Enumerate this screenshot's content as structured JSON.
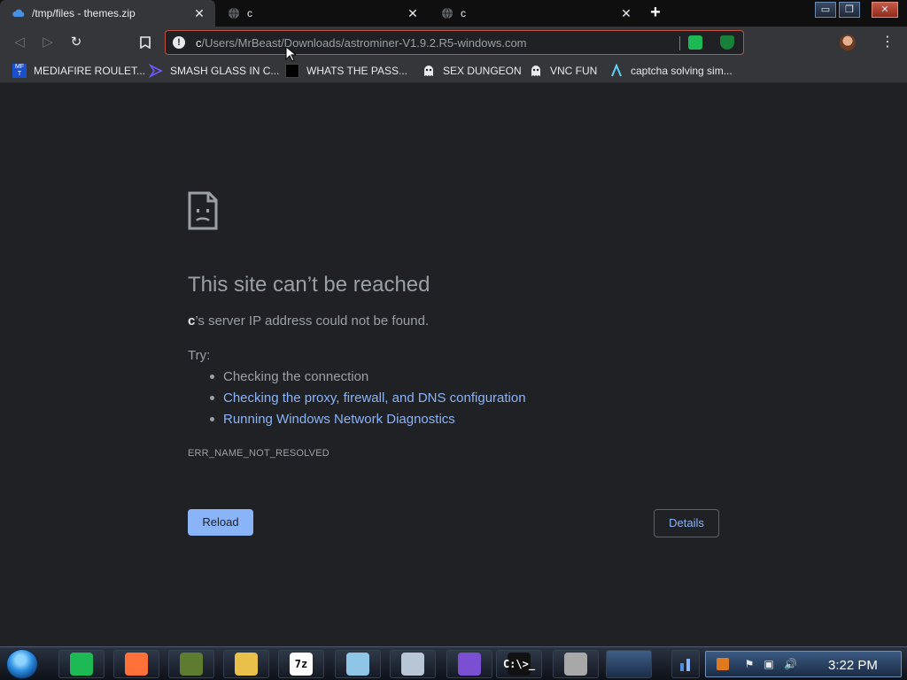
{
  "tabs": [
    {
      "title": "/tmp/files - themes.zip",
      "active": true,
      "favicon": "cloud-icon"
    },
    {
      "title": "c",
      "active": false,
      "favicon": "globe-icon"
    },
    {
      "title": "c",
      "active": false,
      "favicon": "globe-icon"
    }
  ],
  "window_controls": {
    "minimize": "▭",
    "restore": "❐",
    "close": "✕"
  },
  "toolbar": {
    "back": "◁",
    "forward": "▷",
    "reload": "↻",
    "bookmark": "🔖",
    "info": "!",
    "url_host": "c",
    "url_path": "/Users/MrBeast/Downloads/astrominer-V1.9.2.R5-windows.com",
    "menu": "⋮"
  },
  "bookmarks": [
    {
      "label": "MEDIAFIRE ROULET...",
      "icon": "mft-icon"
    },
    {
      "label": "SMASH GLASS IN C...",
      "icon": "visual-studio-icon"
    },
    {
      "label": "WHATS THE PASS...",
      "icon": "lock-icon"
    },
    {
      "label": "SEX DUNGEON",
      "icon": "ghost-icon"
    },
    {
      "label": "VNC FUN",
      "icon": "ghost-icon"
    },
    {
      "label": "captcha solving sim...",
      "icon": "lambda-icon"
    }
  ],
  "error": {
    "title": "This site can’t be reached",
    "host": "c",
    "description": "’s server IP address could not be found.",
    "try_label": "Try:",
    "suggestions": [
      "Checking the connection",
      "Checking the proxy, firewall, and DNS configuration",
      "Running Windows Network Diagnostics"
    ],
    "code": "ERR_NAME_NOT_RESOLVED",
    "reload_label": "Reload",
    "details_label": "Details"
  },
  "taskbar": {
    "apps": [
      {
        "name": "spotify-icon",
        "color": "#1db954",
        "label": ""
      },
      {
        "name": "firefox-icon",
        "color": "#ff7139",
        "label": ""
      },
      {
        "name": "minecraft-icon",
        "color": "#5d7c2f",
        "label": ""
      },
      {
        "name": "file-explorer-icon",
        "color": "#e8c04a",
        "label": ""
      },
      {
        "name": "7zip-icon",
        "color": "#ffffff",
        "label": "7z"
      },
      {
        "name": "notepad-icon",
        "color": "#8fc6e8",
        "label": ""
      },
      {
        "name": "control-panel-icon",
        "color": "#b9c6d6",
        "label": ""
      },
      {
        "name": "visual-studio-icon",
        "color": "#7b4fd1",
        "label": ""
      },
      {
        "name": "cmd-icon",
        "color": "#111111",
        "label": "C:\\>_"
      },
      {
        "name": "firewall-icon",
        "color": "#a8a8a8",
        "label": ""
      }
    ],
    "clock": "3:22 PM"
  },
  "colors": {
    "accent": "#8ab4f8",
    "background": "#202124",
    "omnibox_border": "#c0513e"
  }
}
